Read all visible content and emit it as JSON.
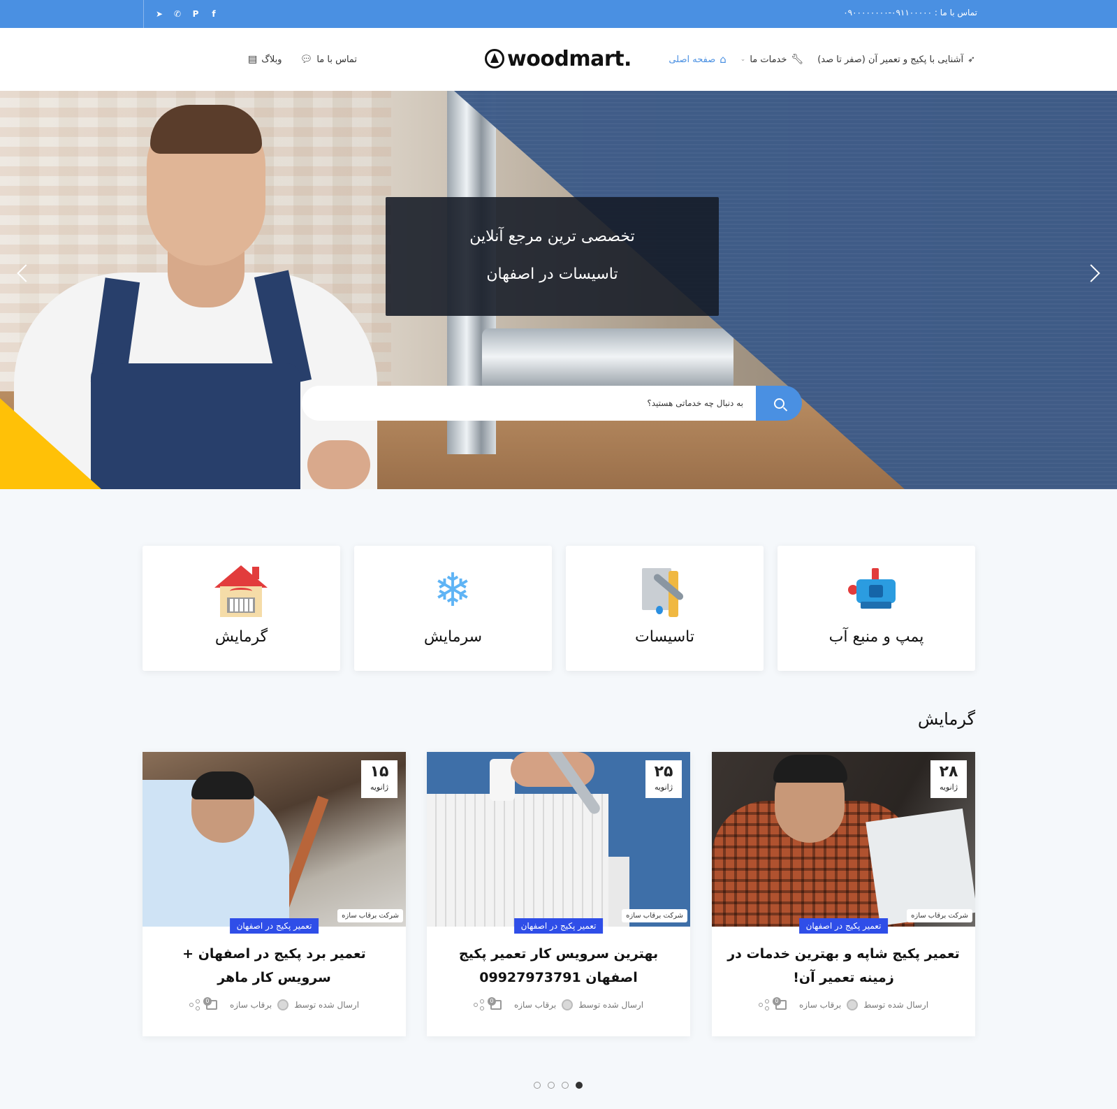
{
  "topbar": {
    "contact": "تماس با ما : ۰۹۱۱۰۰۰۰۰-۰۹۰۰۰۰۰۰۰۰",
    "social": [
      {
        "icon": "facebook-icon",
        "glyph": "f"
      },
      {
        "icon": "pinterest-icon",
        "glyph": "P"
      },
      {
        "icon": "whatsapp-icon",
        "glyph": "✆"
      },
      {
        "icon": "telegram-icon",
        "glyph": "➤"
      }
    ]
  },
  "header": {
    "logo": "woodmart.",
    "nav": [
      {
        "label": "صفحه اصلی",
        "icon": "home-icon"
      },
      {
        "label": "خدمات ما",
        "icon": "wrench-icon"
      },
      {
        "label": "آشنایی با پکیج و تعمیر آن (صفر تا صد)",
        "icon": "rocket-icon"
      }
    ],
    "nav_left": [
      {
        "label": "وبلاگ",
        "icon": "newspaper-icon"
      },
      {
        "label": "تماس با ما",
        "icon": "chat-icon"
      }
    ]
  },
  "hero": {
    "line1": "تخصصی ترین مرجع آنلاین",
    "line2": "تاسیسات در اصفهان",
    "search_placeholder": "به دنبال چه خدماتی هستید؟"
  },
  "services": [
    {
      "label": "پمپ و منبع آب",
      "icon": "water-pump-icon"
    },
    {
      "label": "تاسیسات",
      "icon": "plumbing-tools-icon"
    },
    {
      "label": "سرمایش",
      "icon": "snowflake-icon"
    },
    {
      "label": "گرمایش",
      "icon": "house-heating-icon"
    }
  ],
  "section_title": "گرمایش",
  "posts": [
    {
      "day": "۲۸",
      "month": "ژانویه",
      "watermark": "شرکت برقاب سازه",
      "category": "تعمیر پکیج در اصفهان",
      "title": "تعمیر پکیج شاپه و بهترین خدمات در زمینه تعمیر آن!",
      "posted_by": "ارسال شده توسط",
      "author": "برقاب سازه",
      "comments": "0"
    },
    {
      "day": "۲۵",
      "month": "ژانویه",
      "watermark": "شرکت برقاب سازه",
      "category": "تعمیر پکیج در اصفهان",
      "title": "بهترین سرویس کار تعمیر پکیج اصفهان 09927973791",
      "posted_by": "ارسال شده توسط",
      "author": "برقاب سازه",
      "comments": "0"
    },
    {
      "day": "۱۵",
      "month": "ژانویه",
      "watermark": "شرکت برقاب سازه",
      "category": "تعمیر پکیج در اصفهان",
      "title": "تعمیر برد پکیج در اصفهان + سرویس کار ماهر",
      "posted_by": "ارسال شده توسط",
      "author": "برقاب سازه",
      "comments": "0"
    }
  ],
  "colors": {
    "primary": "#4a90e2",
    "hero_blue": "#3c5a87",
    "accent_yellow": "#ffc107",
    "category_badge": "#2f4ee8"
  },
  "carousel": {
    "pages": 4,
    "active_page": 1
  }
}
